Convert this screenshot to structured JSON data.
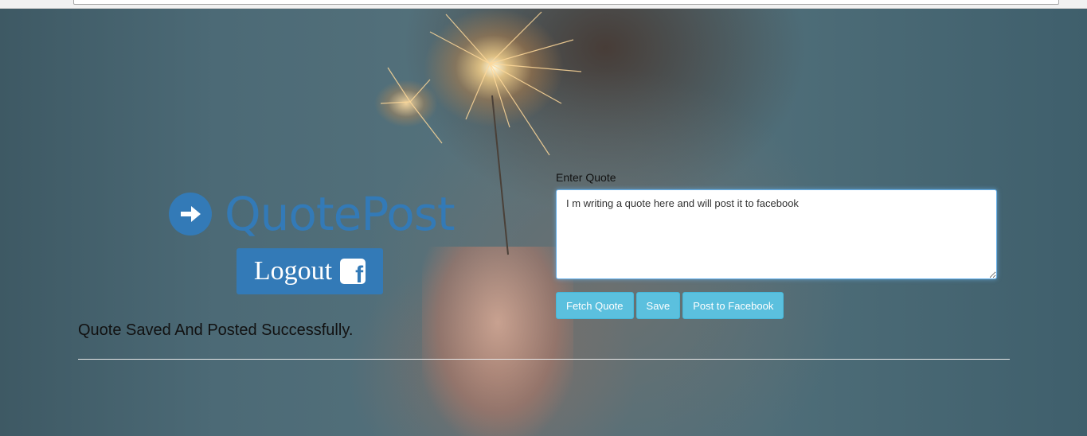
{
  "app": {
    "logo_text": "QuotePost",
    "logo_icon": "arrow-circle-right-icon",
    "brand_color": "#337ab7"
  },
  "auth": {
    "logout_label": "Logout",
    "facebook_icon": "facebook-square-icon"
  },
  "status": {
    "message": "Quote Saved And Posted Successfully."
  },
  "quote_form": {
    "label": "Enter Quote",
    "value": "I m writing a quote here and will post it to facebook",
    "button_color": "#5bc0de",
    "buttons": {
      "fetch": "Fetch Quote",
      "save": "Save",
      "post": "Post to Facebook"
    }
  }
}
